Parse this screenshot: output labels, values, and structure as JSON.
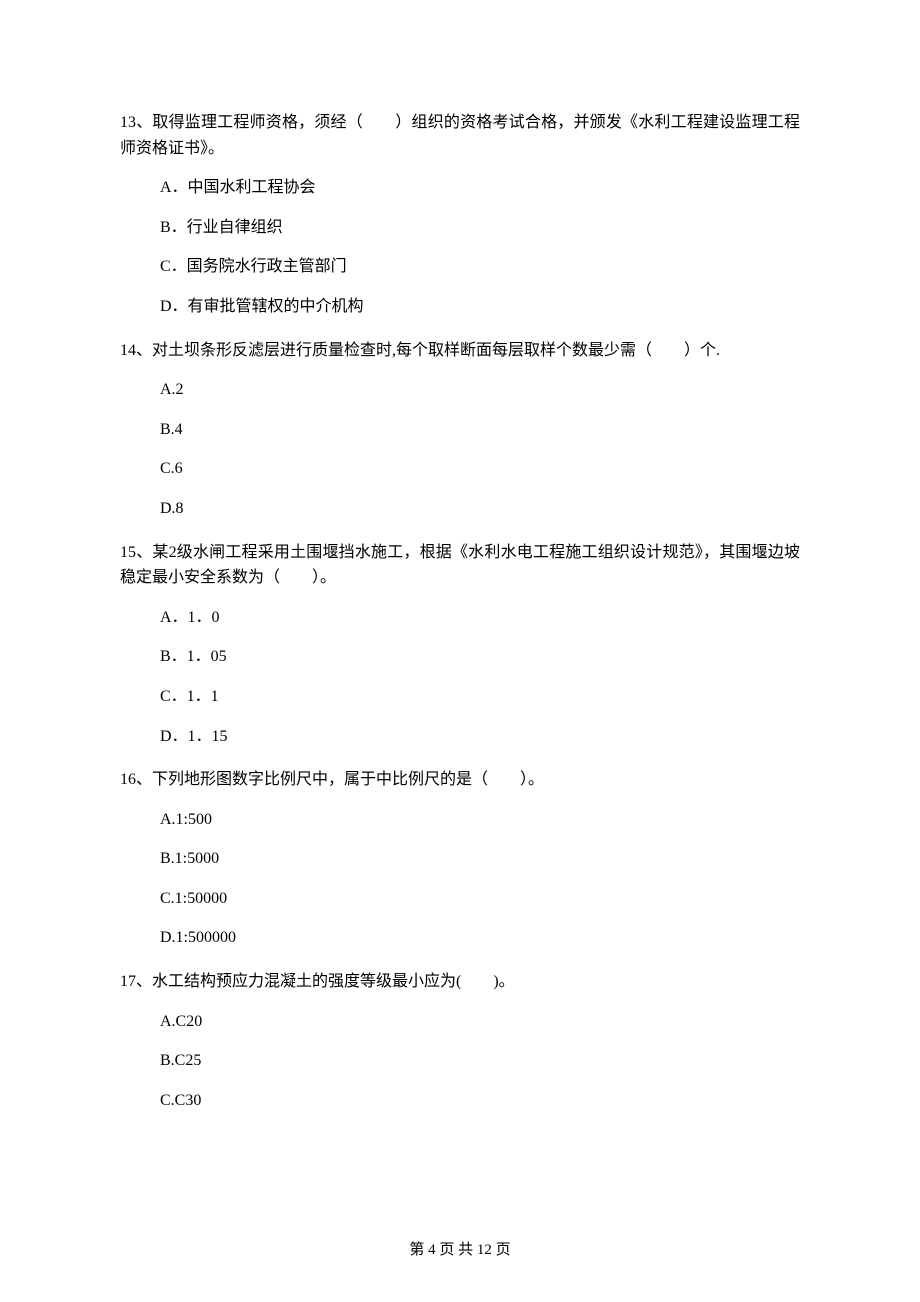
{
  "questions": [
    {
      "num": "13",
      "text": "13、取得监理工程师资格，须经（　　）组织的资格考试合格，并颁发《水利工程建设监理工程师资格证书》。",
      "options": [
        "A．中国水利工程协会",
        "B．行业自律组织",
        "C．国务院水行政主管部门",
        "D．有审批管辖权的中介机构"
      ]
    },
    {
      "num": "14",
      "text": "14、对土坝条形反滤层进行质量检查时,每个取样断面每层取样个数最少需（　　）个.",
      "options": [
        "A.2",
        "B.4",
        "C.6",
        "D.8"
      ]
    },
    {
      "num": "15",
      "text": "15、某2级水闸工程采用土围堰挡水施工，根据《水利水电工程施工组织设计规范》，其围堰边坡稳定最小安全系数为（　　）。",
      "options": [
        "A．1．0",
        "B．1．05",
        "C．1．1",
        "D．1．15"
      ]
    },
    {
      "num": "16",
      "text": "16、下列地形图数字比例尺中，属于中比例尺的是（　　）。",
      "options": [
        "A.1:500",
        "B.1:5000",
        "C.1:50000",
        "D.1:500000"
      ]
    },
    {
      "num": "17",
      "text": "17、水工结构预应力混凝土的强度等级最小应为(　　)。",
      "options": [
        "A.C20",
        "B.C25",
        "C.C30"
      ]
    }
  ],
  "footer": "第 4 页 共 12 页"
}
